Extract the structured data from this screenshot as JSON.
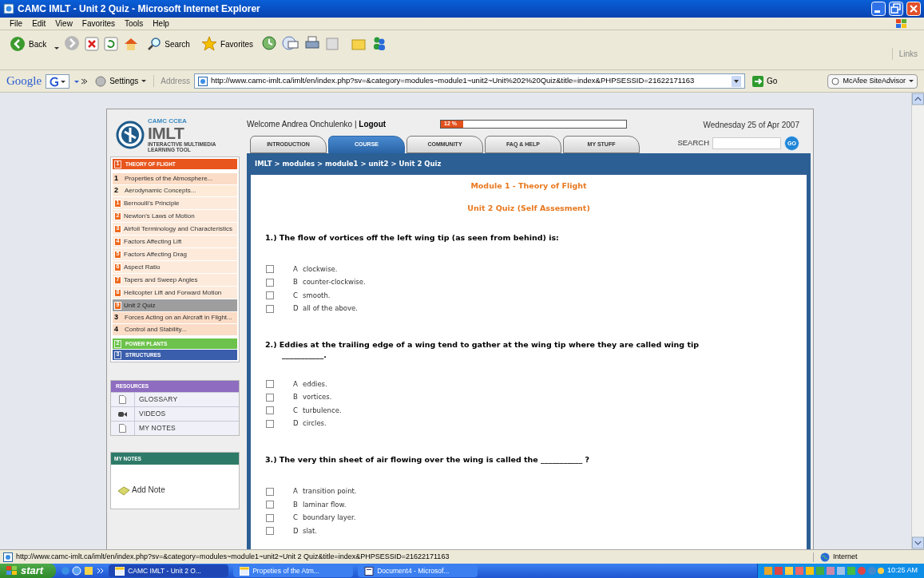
{
  "window": {
    "title": "CAMC IMLT - Unit 2 Quiz - Microsoft Internet Explorer"
  },
  "menu": [
    "File",
    "Edit",
    "View",
    "Favorites",
    "Tools",
    "Help"
  ],
  "toolbar": {
    "back": "Back",
    "search": "Search",
    "favorites": "Favorites",
    "links": "Links"
  },
  "address_bar": {
    "google": "Google",
    "settings": "Settings",
    "label": "Address",
    "url": "http://www.camc-imlt.ca/imlt/en/index.php?sv=&category=modules~module1~unit2~Unit%202%20Quiz&title=index&PHPSESSID=21622171163",
    "go": "Go",
    "mcafee": "McAfee SiteAdvisor"
  },
  "header": {
    "welcome": "Welcome Andrea Onchulenko | ",
    "logout": "Logout",
    "progress": {
      "label": "12 %",
      "level": 0.12
    },
    "date": "Wednesday 25 of Apr 2007",
    "search_label": "SEARCH",
    "go": "GO"
  },
  "logo": {
    "top": "CAMC CCEA",
    "name": "IMLT",
    "subtitle": "INTERACTIVE MULTIMEDIA LEARNING TOOL"
  },
  "tabs": [
    {
      "label": "INTRODUCTION",
      "selected": false
    },
    {
      "label": "COURSE",
      "selected": true
    },
    {
      "label": "COMMUNITY",
      "selected": false
    },
    {
      "label": "FAQ & HELP",
      "selected": false
    },
    {
      "label": "MY STUFF",
      "selected": false
    }
  ],
  "sidebar": {
    "sections": [
      {
        "number": "1",
        "label": "THEORY OF FLIGHT",
        "color": "#e8561e",
        "items": [
          {
            "number": "1",
            "label": "Properties of the Atmosphere..."
          },
          {
            "number": "2",
            "label": "Aerodynamic Concepts...",
            "children": [
              {
                "number": "1",
                "label": "Bernoulli's Principle",
                "selected": false
              },
              {
                "number": "2",
                "label": "Newton's Laws of Motion",
                "selected": false
              },
              {
                "number": "3",
                "label": "Airfoil Terminology and Characteristics",
                "selected": false
              },
              {
                "number": "4",
                "label": "Factors Affecting Lift",
                "selected": false
              },
              {
                "number": "5",
                "label": "Factors Affecting Drag",
                "selected": false
              },
              {
                "number": "6",
                "label": "Aspect Ratio",
                "selected": false
              },
              {
                "number": "7",
                "label": "Tapers and Sweep Angles",
                "selected": false
              },
              {
                "number": "8",
                "label": "Helicopter Lift and Forward Motion",
                "selected": false
              },
              {
                "number": "9",
                "label": "Unit 2 Quiz",
                "selected": true
              }
            ]
          },
          {
            "number": "3",
            "label": "Forces Acting on an Aircraft in Flight..."
          },
          {
            "number": "4",
            "label": "Control and Stability..."
          }
        ]
      },
      {
        "number": "2",
        "label": "POWER PLANTS",
        "color": "#6cc24a"
      },
      {
        "number": "3",
        "label": "STRUCTURES",
        "color": "#3a5eab"
      }
    ]
  },
  "resources": {
    "title": "RESOURCES",
    "items": [
      {
        "kind": "document",
        "label": "GLOSSARY"
      },
      {
        "kind": "video",
        "label": "VIDEOS"
      },
      {
        "kind": "document",
        "label": "MY NOTES"
      }
    ]
  },
  "my_notes": {
    "title": "MY NOTES",
    "add": "Add Note"
  },
  "breadcrumb": "IMLT > modules > module1 > unit2 > Unit 2 Quiz",
  "quiz": {
    "module_title": "Module 1 - Theory of Flight",
    "title": "Unit 2 Quiz (Self Assesment)",
    "questions": [
      {
        "text": "1.) The flow of vortices off the left wing tip (as seen from behind) is:",
        "options": [
          {
            "letter": "A",
            "text": "clockwise.",
            "checked": false
          },
          {
            "letter": "B",
            "text": "counter-clockwise.",
            "checked": false
          },
          {
            "letter": "C",
            "text": "smooth.",
            "checked": false
          },
          {
            "letter": "D",
            "text": "all of the above.",
            "checked": false
          }
        ]
      },
      {
        "text": "2.) Eddies at the trailing edge of a wing tend to gather at the wing tip where they are called wing tip",
        "blank": "___________.",
        "options": [
          {
            "letter": "A",
            "text": "eddies.",
            "checked": false
          },
          {
            "letter": "B",
            "text": "vortices.",
            "checked": false
          },
          {
            "letter": "C",
            "text": "turbulence.",
            "checked": false
          },
          {
            "letter": "D",
            "text": "circles.",
            "checked": false
          }
        ]
      },
      {
        "text": "3.) The very thin sheet of air flowing over the wing is called the ___________ ?",
        "options": [
          {
            "letter": "A",
            "text": "transition point.",
            "checked": false
          },
          {
            "letter": "B",
            "text": "laminar flow.",
            "checked": false
          },
          {
            "letter": "C",
            "text": "boundary layer.",
            "checked": false
          },
          {
            "letter": "D",
            "text": "slat.",
            "checked": false
          }
        ]
      }
    ]
  },
  "status_bar": {
    "url": "http://www.camc-imlt.ca/imlt/en/index.php?sv=&category=modules~module1~unit2~Unit 2 Quiz&title=index&PHPSESSID=21622171163",
    "zone": "Internet"
  },
  "taskbar": {
    "start": "start",
    "tasks": [
      "CAMC IMLT - Unit 2 O...",
      "Propeties of the Atm...",
      "Document4 - Microsof..."
    ],
    "clock": "10:25 AM"
  }
}
